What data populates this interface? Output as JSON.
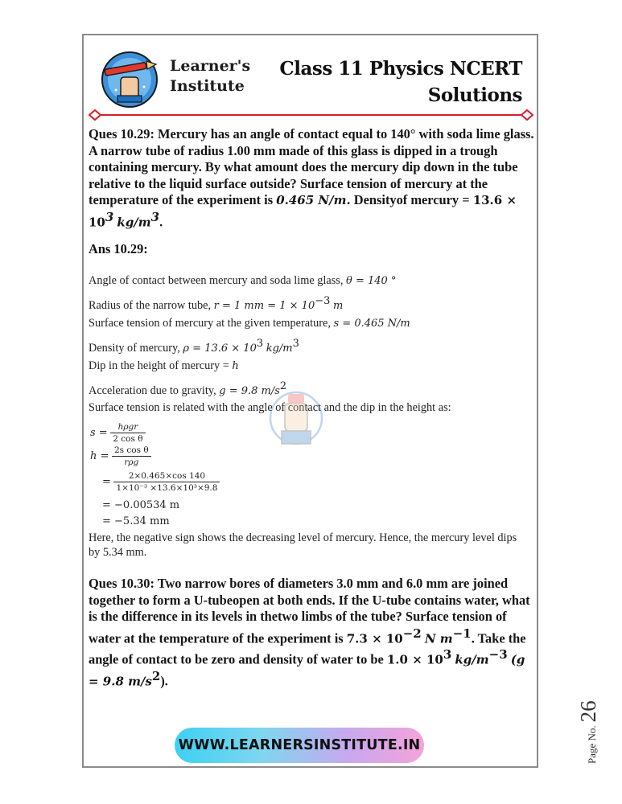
{
  "header": {
    "brand_line1": "Learner's",
    "brand_line2": "Institute",
    "title_line1": "Class 11 Physics NCERT",
    "title_line2": "Solutions"
  },
  "question_1": {
    "text": "Ques 10.29: Mercury has an angle of contact equal to 140° with soda lime glass. A narrow tube of radius 1.00 mm made of this glass is dipped in a trough containing mercury. By what amount does the mercury dip down in the tube relative to the liquid surface outside? Surface tension of mercury at the temperature of the experiment is",
    "surface_tension": "0.465 N/m.",
    "density_label": "Densityof mercury =",
    "density_value": "13.6 × 10",
    "density_exp": "3",
    "density_unit": "kg/m",
    "density_unit_exp": "3",
    "end": "."
  },
  "answer_1": {
    "heading": "Ans 10.29:",
    "lines": {
      "angle_label": "Angle of contact between mercury and soda lime glass,",
      "angle_math": "θ = 140 °",
      "radius_label": "Radius of the narrow tube,",
      "radius_math": "r = 1 mm = 1 × 10",
      "radius_exp": "−3",
      "radius_unit": "m",
      "st_label": "Surface tension of mercury at the given temperature,",
      "st_math": "s = 0.465 N/m",
      "density_label": "Density of mercury,",
      "density_math": "ρ = 13.6 × 10",
      "density_exp": "3",
      "density_unit": "kg/m",
      "density_unit_exp": "3",
      "dip_label": "Dip in the height of mercury =",
      "dip_var": "h",
      "g_label": "Acceleration due to gravity,",
      "g_math": "g = 9.8 m/s",
      "g_exp": "2",
      "relation": "Surface tension is related with the angle of contact and the dip in the height as:"
    },
    "equations": {
      "s_lhs": "s =",
      "s_num": "hρgr",
      "s_den": "2 cos θ",
      "h_lhs": "h =",
      "h_num": "2s cos θ",
      "h_den": "rρg",
      "eq": "=",
      "sub_num": "2×0.465×cos 140",
      "sub_den": "1×10⁻³ ×13.6×10³×9.8",
      "r1": "= −0.00534 m",
      "r2": "= −5.34 mm"
    },
    "conclusion": "Here, the negative sign shows the decreasing level of mercury. Hence, the mercury level dips by 5.34 mm."
  },
  "question_2": {
    "text": "Ques 10.30: Two narrow bores of diameters 3.0 mm and 6.0 mm are joined together to form a U-tubeopen at both ends. If the U-tube contains water, what is the difference in its levels in thetwo limbs of the tube? Surface tension of water at the temperature of the experiment is",
    "st_math": "7.3 × 10",
    "st_exp": "−2",
    "st_unit": "N m",
    "st_unit_exp": "−1",
    "mid": ". Take the angle of contact to be zero and density of water to be",
    "density_math": "1.0 × 10",
    "density_exp": "3",
    "density_unit": "kg/m",
    "density_unit_exp": "−3",
    "g_part": "(g = 9.8 m/s",
    "g_exp": "2",
    "end": ")."
  },
  "footer": {
    "url": "WWW.LEARNERSINSTITUTE.IN",
    "page_label": "Page No.",
    "page_number": "26"
  },
  "colors": {
    "divider_red": "#d61f2c",
    "url_gradient_start": "#3ed0f3",
    "url_gradient_end": "#f4a3d9",
    "logo_blue": "#1e6fbf",
    "logo_red": "#e0392f"
  },
  "icons": [
    "logo-pen-hand-icon",
    "watermark-hand-icon"
  ]
}
